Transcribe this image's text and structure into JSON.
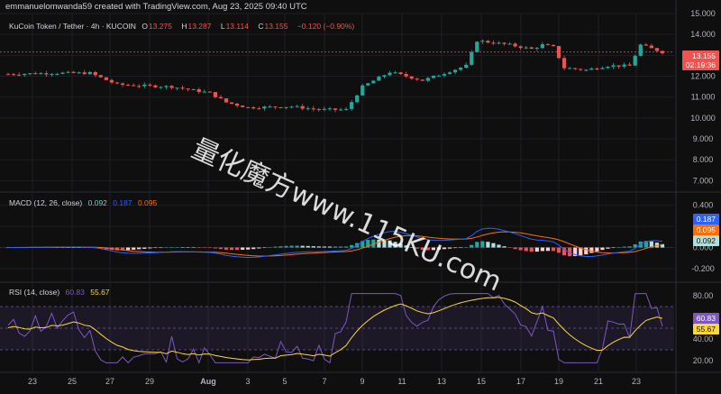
{
  "header": {
    "text": "emmanuelomwanda59 created with TradingView.com, Aug 23, 2025 09:40 UTC"
  },
  "price_legend": {
    "title": "KuCoin Token / Tether · 4h · KUCOIN",
    "o_label": "O",
    "o": "13.275",
    "h_label": "H",
    "h": "13.287",
    "l_label": "L",
    "l": "13.114",
    "c_label": "C",
    "c": "13.155",
    "change": "−0.120 (−0.90%)"
  },
  "macd_legend": {
    "title": "MACD (12, 26, close)",
    "v1": "0.092",
    "v2": "0.187",
    "v3": "0.095"
  },
  "rsi_legend": {
    "title": "RSI (14, close)",
    "v1": "60.83",
    "v2": "55.67"
  },
  "price_tag": {
    "value": "13.155",
    "countdown": "02:19:36"
  },
  "macd_tags": {
    "signal": "0.187",
    "macd": "0.095",
    "hist": "0.092"
  },
  "rsi_tags": {
    "rsi": "60.83",
    "ma": "55.67"
  },
  "watermark": "量化魔方www.115KU.com",
  "colors": {
    "up": "#26a69a",
    "down": "#ef5350",
    "macd_line": "#2962ff",
    "signal_line": "#ff6d00",
    "rsi_line": "#7e57c2",
    "rsi_ma": "#fdd835"
  },
  "chart_data": [
    {
      "type": "candlestick",
      "title": "KuCoin Token / Tether · 4h · KUCOIN",
      "y_ticks": [
        7.0,
        8.0,
        9.0,
        10.0,
        11.0,
        12.0,
        13.0,
        14.0,
        15.0
      ],
      "ylim": [
        6.5,
        15.0
      ],
      "x_ticks": [
        "23",
        "25",
        "27",
        "29",
        "Aug",
        "3",
        "5",
        "7",
        "9",
        "11",
        "13",
        "15",
        "17",
        "19",
        "21",
        "23"
      ],
      "current_price": 13.155,
      "path": [
        [
          0,
          12.1
        ],
        [
          8,
          12.15
        ],
        [
          15,
          12.15
        ],
        [
          20,
          11.6
        ],
        [
          24,
          11.55
        ],
        [
          30,
          11.5
        ],
        [
          37,
          11.2
        ],
        [
          40,
          10.75
        ],
        [
          44,
          10.5
        ],
        [
          52,
          10.55
        ],
        [
          57,
          10.4
        ],
        [
          62,
          10.4
        ],
        [
          65,
          11.5
        ],
        [
          70,
          12.2
        ],
        [
          76,
          11.8
        ],
        [
          84,
          12.5
        ],
        [
          86,
          13.7
        ],
        [
          92,
          13.5
        ],
        [
          96,
          13.3
        ],
        [
          98,
          13.5
        ],
        [
          100,
          13.4
        ],
        [
          102,
          12.4
        ],
        [
          106,
          12.3
        ],
        [
          110,
          12.5
        ],
        [
          114,
          12.5
        ],
        [
          116,
          13.5
        ],
        [
          120,
          13.15
        ]
      ]
    },
    {
      "type": "macd",
      "title": "MACD (12, 26, close)",
      "y_ticks": [
        -0.2,
        0.0,
        0.2,
        0.4
      ],
      "ylim": [
        -0.32,
        0.5
      ],
      "values": {
        "histogram": 0.092,
        "macd": 0.095,
        "signal": 0.187
      }
    },
    {
      "type": "rsi",
      "title": "RSI (14, close)",
      "y_ticks": [
        20,
        40,
        60,
        80
      ],
      "ylim": [
        10,
        90
      ],
      "bands": [
        30,
        50,
        70
      ],
      "values": {
        "rsi": 60.83,
        "rsi_ma": 55.67
      }
    }
  ]
}
